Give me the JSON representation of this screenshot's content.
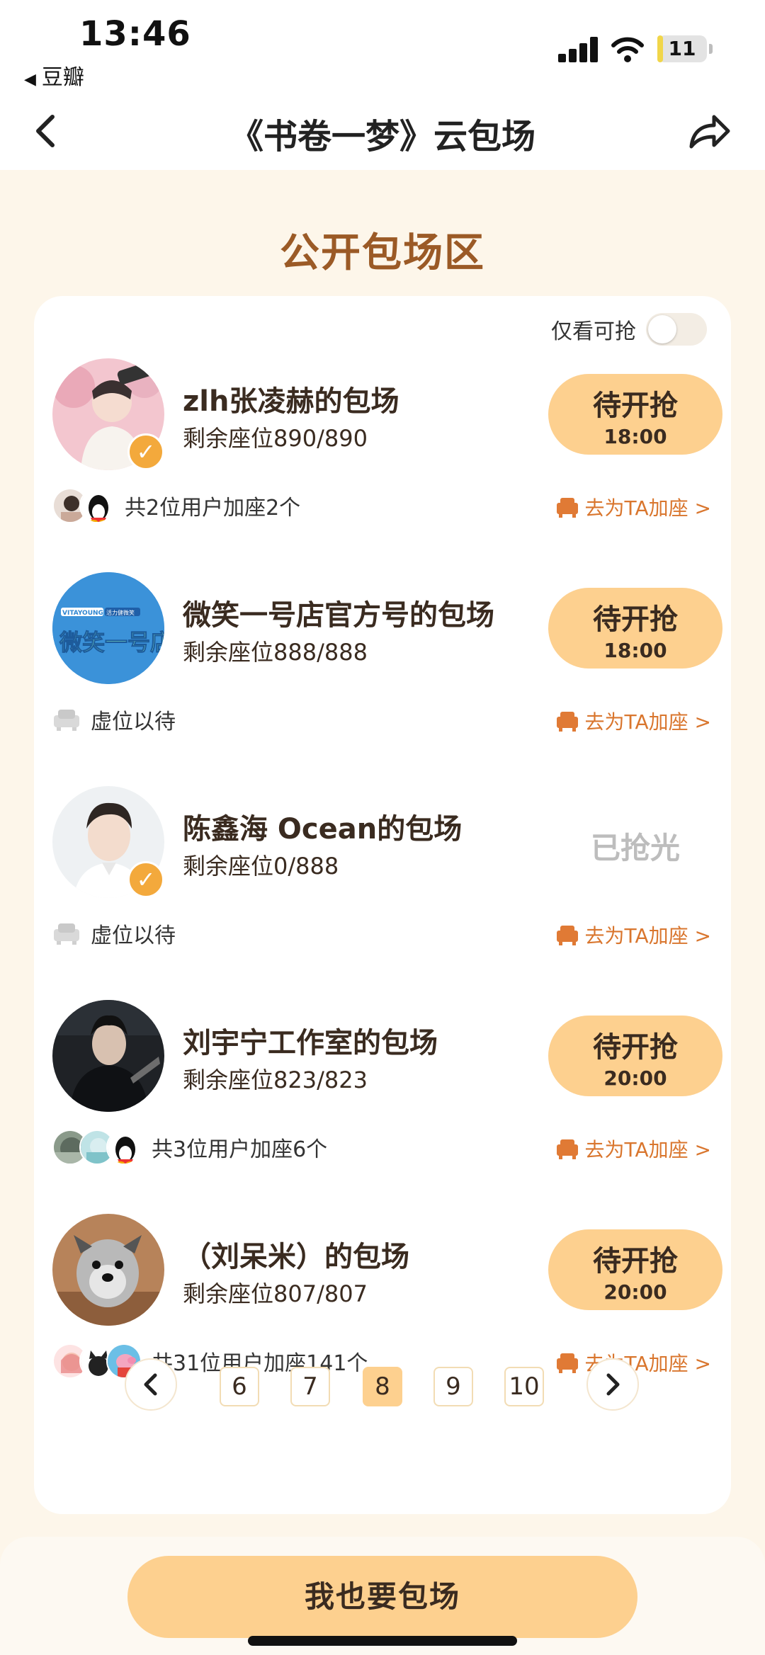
{
  "status_bar": {
    "time": "13:46",
    "back_app": "豆瓣",
    "battery": "11",
    "battery_fraction": 0.11
  },
  "nav": {
    "title": "《书卷一梦》云包场"
  },
  "section_title": "公开包场区",
  "filter": {
    "only_grab_label": "仅看可抢",
    "only_grab_on": false
  },
  "add_seat_label": "去为TA加座 >",
  "rows": [
    {
      "name": "zlh张凌赫的包场",
      "seats": "剩余座位890/890",
      "button": "待开抢",
      "time": "18:00",
      "footer": "共2位用户加座2个",
      "verified": true
    },
    {
      "name": "微笑一号店官方号的包场",
      "seats": "剩余座位888/888",
      "button": "待开抢",
      "time": "18:00",
      "footer": "虚位以待",
      "avatar_text": [
        "VITAYOUNG",
        "活力健微笑",
        "微笑一号店"
      ]
    },
    {
      "name": "陈鑫海 Ocean的包场",
      "seats": "剩余座位0/888",
      "sold_out": "已抢光",
      "footer": "虚位以待",
      "verified": true
    },
    {
      "name": "刘宇宁工作室的包场",
      "seats": "剩余座位823/823",
      "button": "待开抢",
      "time": "20:00",
      "footer": "共3位用户加座6个"
    },
    {
      "name": "（刘呆米）的包场",
      "seats": "剩余座位807/807",
      "button": "待开抢",
      "time": "20:00",
      "footer": "共31位用户加座141个"
    }
  ],
  "pagination": {
    "pages": [
      "6",
      "7",
      "8",
      "9",
      "10"
    ],
    "active": "8"
  },
  "cta": {
    "label": "我也要包场"
  },
  "colors": {
    "accent": "#fdd08f",
    "title_brown": "#9b5a26",
    "link_orange": "#d9762e",
    "background": "#fdf6ea"
  }
}
